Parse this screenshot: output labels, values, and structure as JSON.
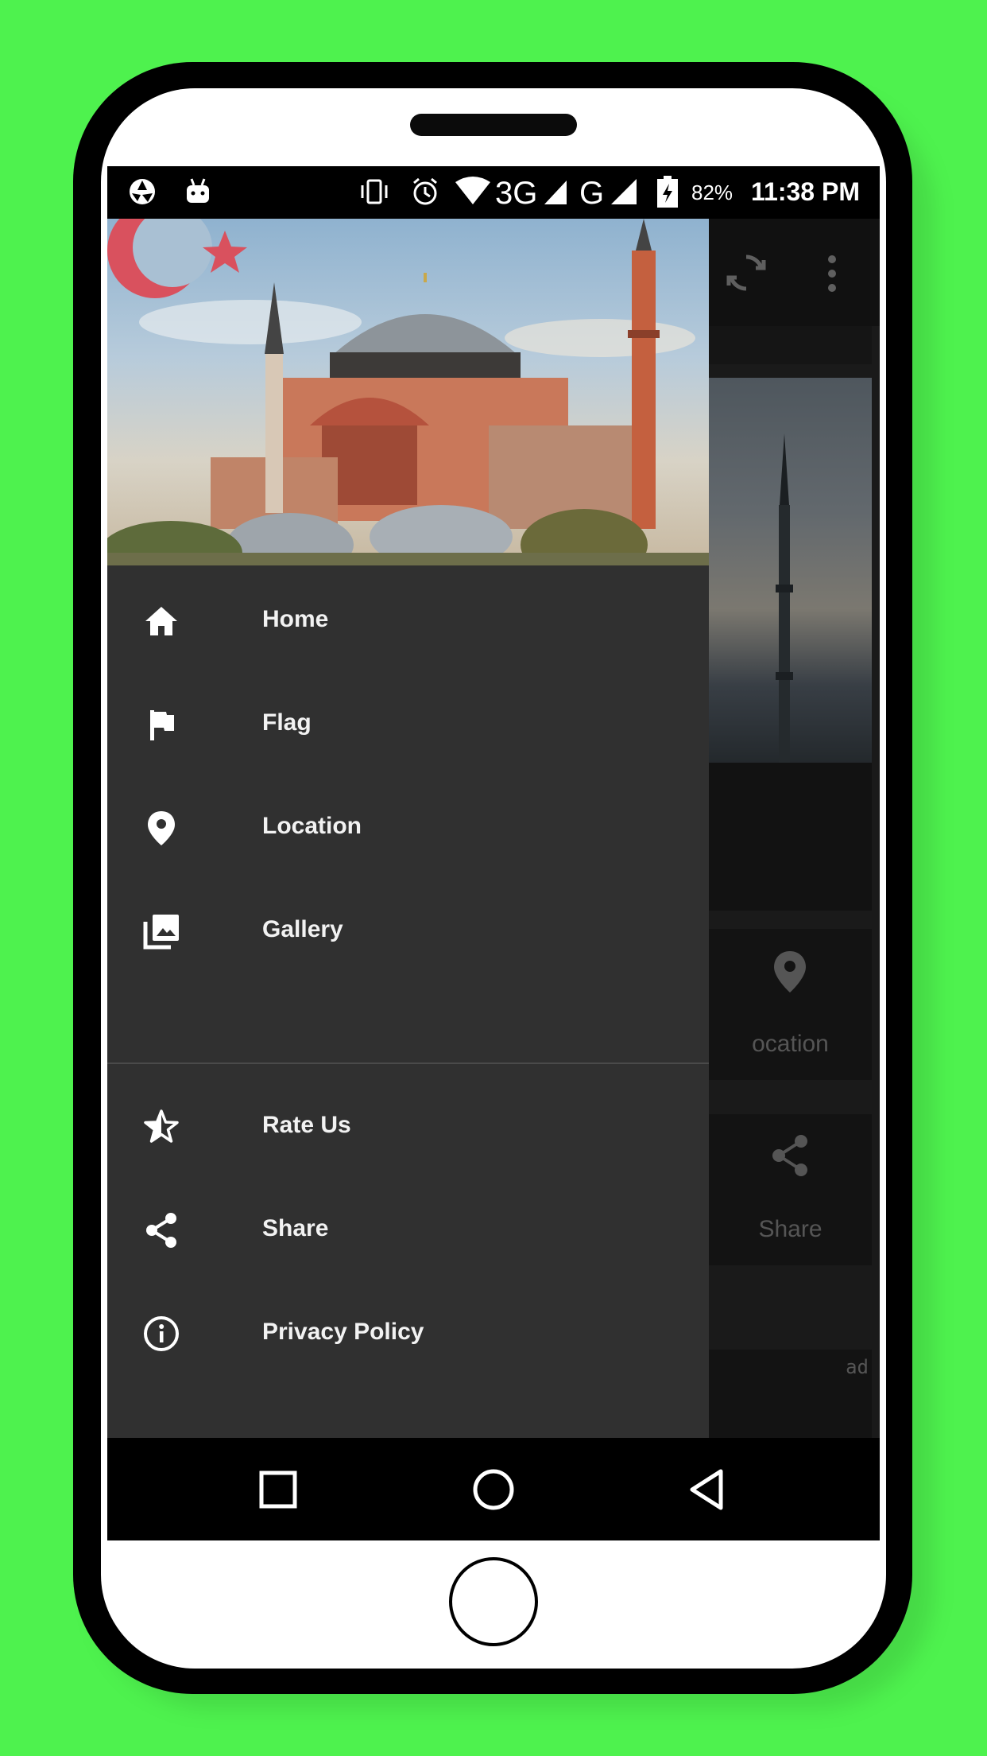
{
  "colors": {
    "background": "#4ef24e",
    "drawer": "#303030",
    "status_bar": "#000000",
    "flag_red": "#e30a17"
  },
  "status_bar": {
    "network_3g": "3G",
    "network_g": "G",
    "battery_percent": "82%",
    "time": "11:38 PM",
    "icons": [
      "aperture-icon",
      "android-icon",
      "vibrate-icon",
      "alarm-icon",
      "wifi-icon",
      "signal-icon",
      "battery-charging-icon"
    ]
  },
  "toolbar": {
    "icons": [
      "refresh-icon",
      "more-vert-icon"
    ]
  },
  "background_content": {
    "tiles": [
      {
        "label": "ocation",
        "icon": "location-icon"
      },
      {
        "label": "Share",
        "icon": "share-icon"
      }
    ],
    "ad_label": "ad"
  },
  "drawer": {
    "menu": [
      {
        "label": "Home",
        "icon": "home-icon"
      },
      {
        "label": "Flag",
        "icon": "flag-icon"
      },
      {
        "label": "Location",
        "icon": "location-icon"
      },
      {
        "label": "Gallery",
        "icon": "gallery-icon"
      }
    ],
    "secondary_menu": [
      {
        "label": "Rate Us",
        "icon": "star-half-icon"
      },
      {
        "label": "Share",
        "icon": "share-icon"
      },
      {
        "label": "Privacy Policy",
        "icon": "info-icon"
      }
    ]
  },
  "nav_bar": {
    "buttons": [
      "recents-button",
      "home-button",
      "back-button"
    ]
  }
}
